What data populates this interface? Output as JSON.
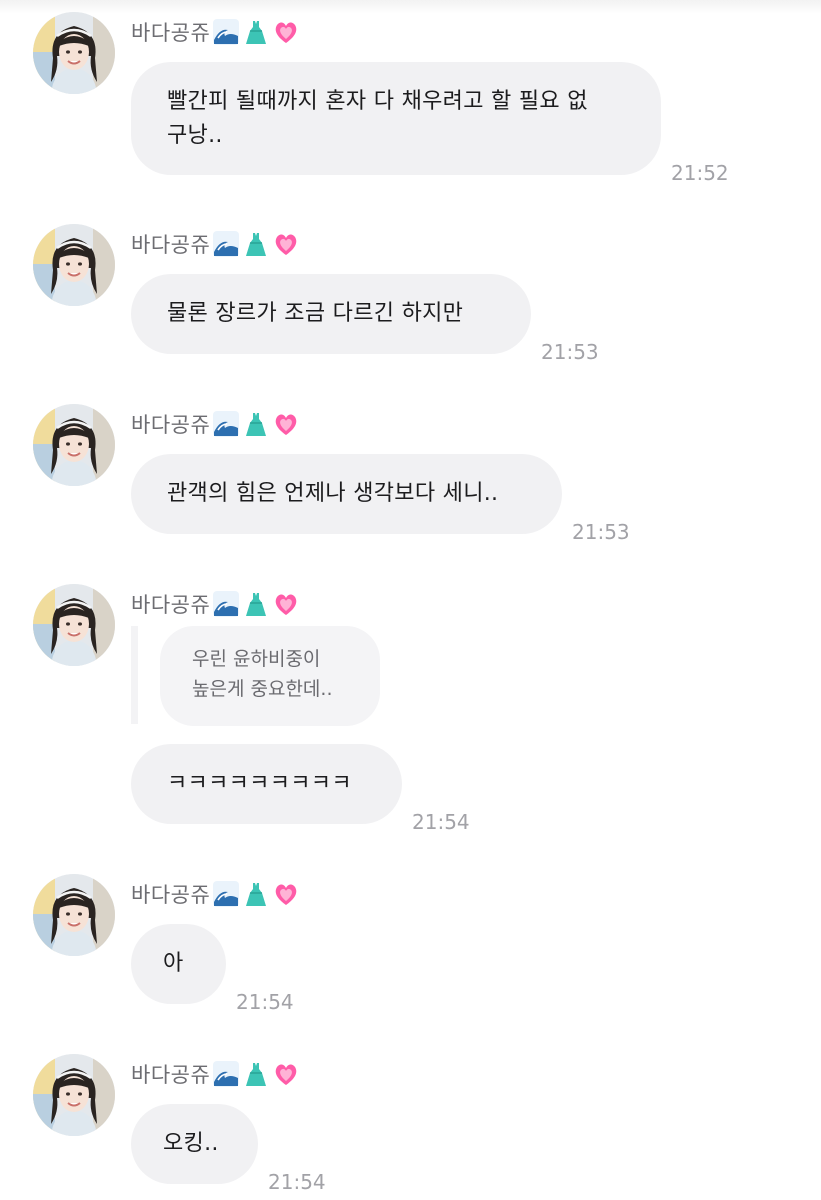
{
  "sender": {
    "name": "바다공쥬",
    "emojis": [
      "wave-emoji",
      "dress-emoji",
      "heart-emoji"
    ]
  },
  "messages": [
    {
      "sender": "바다공쥬",
      "text_line1": "빨간피 될때까지 혼자 다 채우려고 할 필요 없",
      "text_line2": "구낭..",
      "time": "21:52"
    },
    {
      "sender": "바다공쥬",
      "text": "물론 장르가 조금 다르긴 하지만",
      "time": "21:53"
    },
    {
      "sender": "바다공쥬",
      "text": "관객의 힘은 언제나 생각보다 세니..",
      "time": "21:53"
    },
    {
      "sender": "바다공쥬",
      "reply_line1": "우린 윤하비중이",
      "reply_line2": "높은게 중요한데..",
      "text": "ㅋㅋㅋㅋㅋㅋㅋㅋㅋ",
      "time": "21:54"
    },
    {
      "sender": "바다공쥬",
      "text": "아",
      "time": "21:54"
    },
    {
      "sender": "바다공쥬",
      "text": "오킹..",
      "time": "21:54"
    }
  ],
  "colors": {
    "bubble": "#f1f1f3",
    "time": "#a2a2a7",
    "sender": "#6d6d72"
  }
}
